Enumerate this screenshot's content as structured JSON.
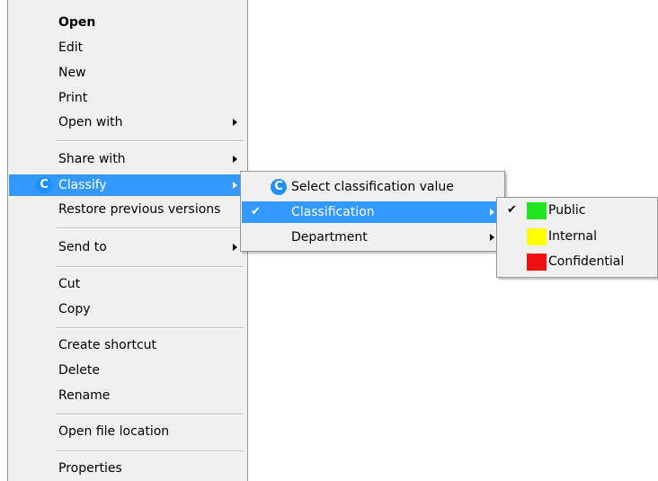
{
  "main_menu": {
    "open": "Open",
    "edit": "Edit",
    "new": "New",
    "print": "Print",
    "open_with": "Open with",
    "share_with": "Share with",
    "classify": "Classify",
    "restore_previous_versions": "Restore previous versions",
    "send_to": "Send to",
    "cut": "Cut",
    "copy": "Copy",
    "create_shortcut": "Create shortcut",
    "delete": "Delete",
    "rename": "Rename",
    "open_file_location": "Open file location",
    "properties": "Properties"
  },
  "classify_submenu": {
    "select_value": "Select classification value",
    "classification": "Classification",
    "department": "Department"
  },
  "classification_submenu": {
    "items": [
      {
        "label": "Public",
        "color": "#22e522",
        "checked": true
      },
      {
        "label": "Internal",
        "color": "#ffff00",
        "checked": false
      },
      {
        "label": "Confidential",
        "color": "#ee1111",
        "checked": false
      }
    ]
  },
  "icons": {
    "classify_icon_letter": "C",
    "checkmark": "✔"
  },
  "colors": {
    "highlight": "#3399ff",
    "menu_background": "#f0f0f0"
  }
}
